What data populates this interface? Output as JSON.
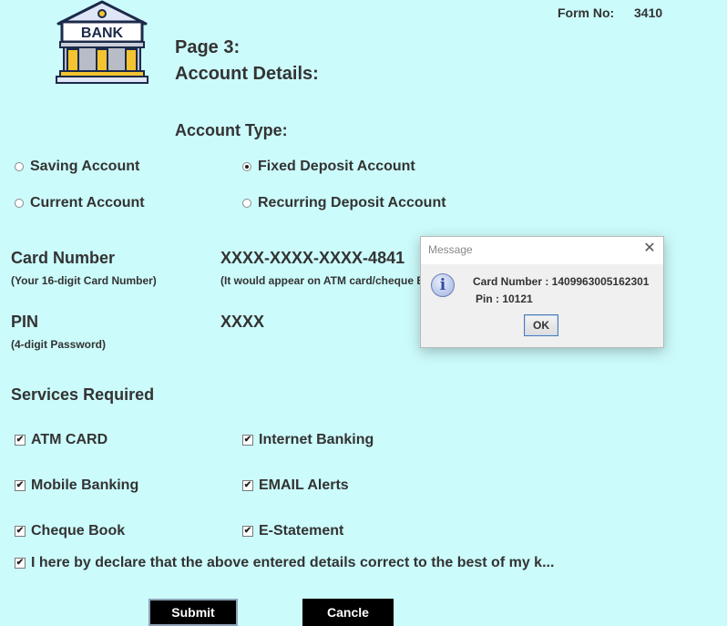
{
  "header": {
    "logo_text": "BANK",
    "form_label": "Form No:",
    "form_number": "3410",
    "page_title_line1": "Page 3:",
    "page_title_line2": "Account Details:"
  },
  "account_type": {
    "heading": "Account Type:",
    "options": [
      {
        "label": "Saving Account",
        "selected": false
      },
      {
        "label": "Fixed Deposit Account",
        "selected": true
      },
      {
        "label": "Current Account",
        "selected": false
      },
      {
        "label": "Recurring Deposit Account",
        "selected": false
      }
    ]
  },
  "card": {
    "label": "Card Number",
    "hint": "(Your 16-digit Card Number)",
    "value": "XXXX-XXXX-XXXX-4841",
    "note": "(It would appear on ATM card/cheque B"
  },
  "pin": {
    "label": "PIN",
    "hint": "(4-digit Password)",
    "value": "XXXX"
  },
  "services": {
    "heading": "Services Required",
    "items": [
      {
        "label": "ATM CARD",
        "checked": true
      },
      {
        "label": "Internet Banking",
        "checked": true
      },
      {
        "label": "Mobile Banking",
        "checked": true
      },
      {
        "label": "EMAIL Alerts",
        "checked": true
      },
      {
        "label": "Cheque Book",
        "checked": true
      },
      {
        "label": "E-Statement",
        "checked": true
      }
    ],
    "declaration": "I here by declare that the above entered details correct to the best of my k...",
    "declaration_checked": true
  },
  "buttons": {
    "submit": "Submit",
    "cancel": "Cancle"
  },
  "dialog": {
    "title": "Message",
    "close_glyph": "✕",
    "icon_glyph": "i",
    "line1": "Card Number :  1409963005162301",
    "line2": "Pin : 10121",
    "ok": "OK"
  }
}
